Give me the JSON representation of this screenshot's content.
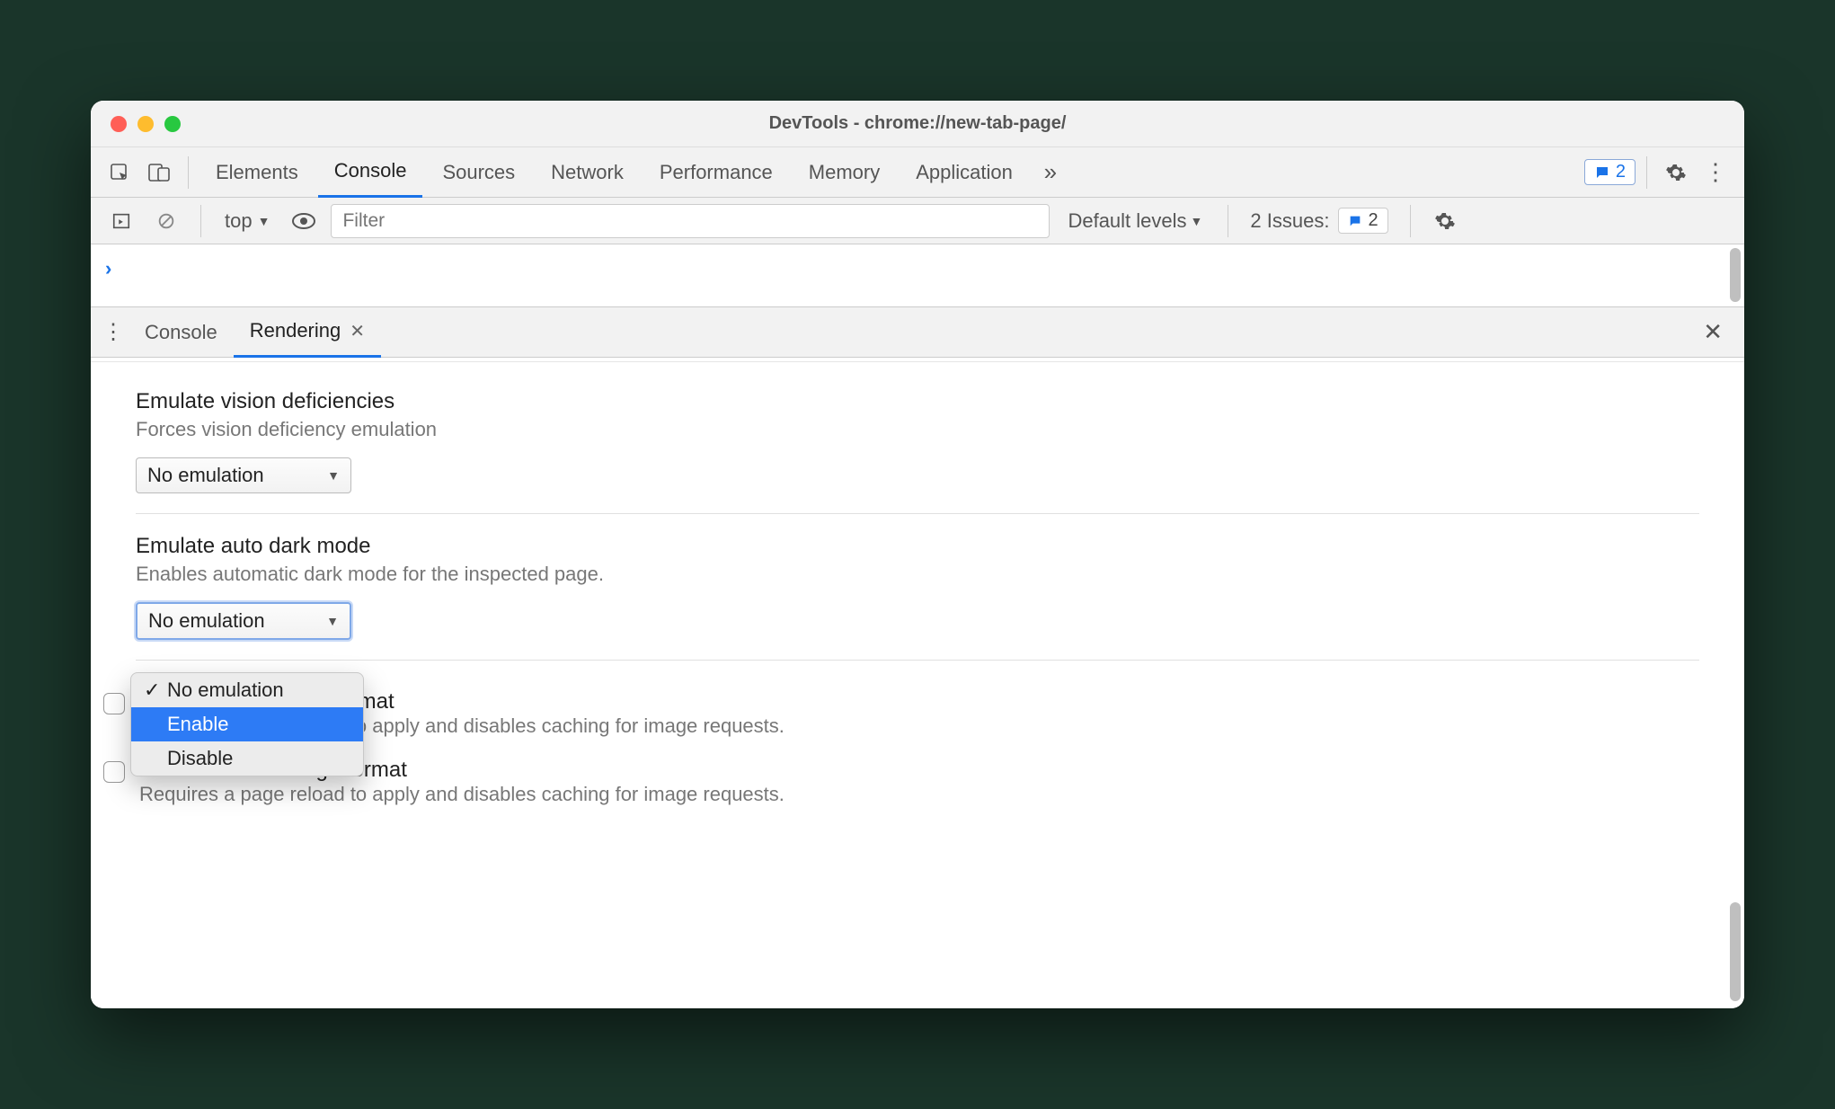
{
  "window": {
    "title": "DevTools - chrome://new-tab-page/"
  },
  "mainTabs": {
    "items": [
      "Elements",
      "Console",
      "Sources",
      "Network",
      "Performance",
      "Memory",
      "Application"
    ],
    "activeIndex": 1,
    "badgeCount": "2"
  },
  "consoleBar": {
    "context": "top",
    "filterPlaceholder": "Filter",
    "levels": "Default levels",
    "issuesLabel": "2 Issues:",
    "issuesCount": "2"
  },
  "drawer": {
    "tabs": [
      {
        "label": "Console",
        "active": false,
        "closable": false
      },
      {
        "label": "Rendering",
        "active": true,
        "closable": true
      }
    ]
  },
  "rendering": {
    "vision": {
      "title": "Emulate vision deficiencies",
      "desc": "Forces vision deficiency emulation",
      "selected": "No emulation"
    },
    "darkmode": {
      "title": "Emulate auto dark mode",
      "desc": "Enables automatic dark mode for the inspected page.",
      "selected": "No emulation",
      "options": [
        "No emulation",
        "Enable",
        "Disable"
      ],
      "highlightIndex": 1,
      "checkedIndex": 0
    },
    "avif": {
      "title": "Disable AVIF image format",
      "desc": "Requires a page reload to apply and disables caching for image requests."
    },
    "webp": {
      "title": "Disable WebP image format",
      "desc": "Requires a page reload to apply and disables caching for image requests."
    }
  }
}
